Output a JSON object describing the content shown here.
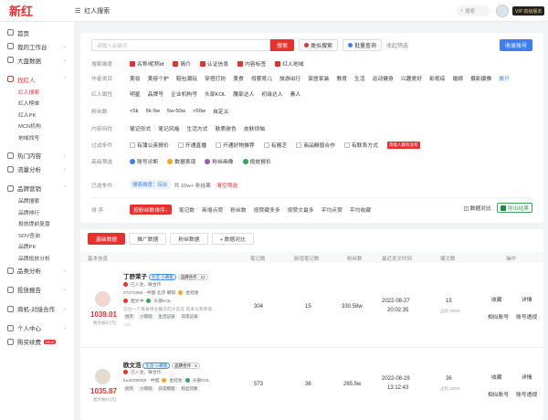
{
  "app": {
    "logo": "新红",
    "breadcrumb": "红人搜索",
    "search_placeholder": "搜索",
    "vip": "VIP 高级版本"
  },
  "sidebar": {
    "items": [
      {
        "label": "首页"
      },
      {
        "label": "我的工作台"
      },
      {
        "label": "大盘数据"
      },
      {
        "label": "找红人"
      },
      {
        "label": "热门内容"
      },
      {
        "label": "流量分析"
      },
      {
        "label": "品牌营销"
      },
      {
        "label": "品类分析"
      },
      {
        "label": "投放报告"
      },
      {
        "label": "商机-对接合作"
      },
      {
        "label": "个人中心"
      },
      {
        "label": "购买续费",
        "badge": "NEW"
      }
    ],
    "sub_find": [
      "红人搜索",
      "红人榜单",
      "红人PK",
      "MCN机构",
      "地域找号"
    ],
    "sub_brand": [
      "品牌搜索",
      "品牌排行",
      "投放提前复盘",
      "SOV查询",
      "品牌PK",
      "品牌投放分析"
    ]
  },
  "filters": {
    "search_placeholder": "请输入关键词",
    "search_btn": "搜索",
    "similar_btn": "类似搜索",
    "batch_btn": "批量查询",
    "collect_link": "收起筛选",
    "claim_btn": "收录账号",
    "match_label": "搜索维度",
    "match_opts": [
      "名称/昵称id",
      "简介",
      "认证信息",
      "内容标签",
      "红人地域"
    ],
    "cat_label": "作者类目",
    "cat_opts": [
      "美妆",
      "美容个护",
      "鞋包潮玩",
      "穿搭打扮",
      "美食",
      "母婴育儿",
      "旅游出行",
      "家居家装",
      "教育",
      "生活",
      "运动健身",
      "兴趣爱好",
      "影视综",
      "婚嫁",
      "摄影摄像"
    ],
    "cat_more": "展开",
    "attr_label": "红人属性",
    "attr_opts": [
      "明星",
      "品牌号",
      "企业机构号",
      "头部KOL",
      "腰部达人",
      "初级达人",
      "素人"
    ],
    "fans_label": "粉丝数",
    "fans_opts": [
      "<5k",
      "5k-5w",
      "5w-50w",
      ">50w",
      "自定义"
    ],
    "content_label": "内容特性",
    "content_opts": [
      "笔记形式",
      "笔记风格",
      "生活方式",
      "肤质肤色",
      "皮肤烦恼"
    ],
    "exclude_label": "过滤条件",
    "exclude_opts": [
      "有蒲公英报价",
      "开通直播",
      "开通好物推荐",
      "有酱芝",
      "商品橱窗合作",
      "有联系方式"
    ],
    "exclude_badge": "高级人群有含有",
    "advanced_label": "高级筛选",
    "advanced_opts": [
      "账号诊断",
      "数据表现",
      "粉丝画像",
      "投放报价"
    ],
    "selected_label": "已选条件",
    "selected_chip": "搜索维度：综合",
    "result_text": "共 10w+ 条结果",
    "clear": "清空筛选"
  },
  "sort": {
    "label": "排 序",
    "opts": [
      "按粉丝数排序↓",
      "笔记数",
      "新增点赞",
      "粉丝数",
      "按赞藏多多",
      "按赞文最多",
      "平均点赞",
      "平均收藏"
    ],
    "compare": "数据对比",
    "export": "导出结果"
  },
  "table": {
    "tabs": [
      "基础数据",
      "推广数据",
      "粉丝数据",
      "+ 数据对比"
    ],
    "headers": [
      "基本信息",
      "笔记数",
      "新增笔记数",
      "粉丝数",
      "最近发文时间",
      "爆文数",
      "操作"
    ],
    "rows": [
      {
        "name": "丁舒茉子",
        "tag": "生活·小萌祖",
        "brand": "品牌合作 · 12",
        "status": "已入驻，联合作",
        "meta": "27271994 · 中国·北京 朝阳",
        "verified": "金冠星",
        "extra": [
          "图文中",
          "头部KOL"
        ],
        "note": "已达一个美食博主最近的大实在 前来与我参来…",
        "tags": [
          "搞笑",
          "小萌瑞",
          "生活记录",
          "日常记录"
        ],
        "price": "1039.01",
        "price_label": "图文报价(元)",
        "notes": "304",
        "new_notes": "15",
        "fans": "330.58w",
        "date": "2022-08-27",
        "time": "20:02:35",
        "hot": "15",
        "hot_sub": "占比 100%",
        "ops": [
          "收藏",
          "详情",
          "相似账号",
          "账号透视"
        ]
      },
      {
        "name": "欧文浩",
        "tag": "生活·小萌祖",
        "brand": "品牌合作 · 3",
        "status": "已入驻，联合作",
        "meta": "fuu3200000 · 中国",
        "verified": "金冠星",
        "extra": [
          "头部KOL"
        ],
        "note": "",
        "tags": [
          "搞笑",
          "小萌瑞",
          "日常模版",
          "粉丝印象"
        ],
        "price": "1035.87",
        "price_label": "图文报价(元)",
        "notes": "573",
        "new_notes": "36",
        "fans": "265.5w",
        "date": "2022-08-29",
        "time": "13:12:43",
        "hot": "36",
        "hot_sub": "占比 100%",
        "ops": [
          "收藏",
          "详情",
          "相似账号",
          "账号透视"
        ]
      }
    ]
  }
}
